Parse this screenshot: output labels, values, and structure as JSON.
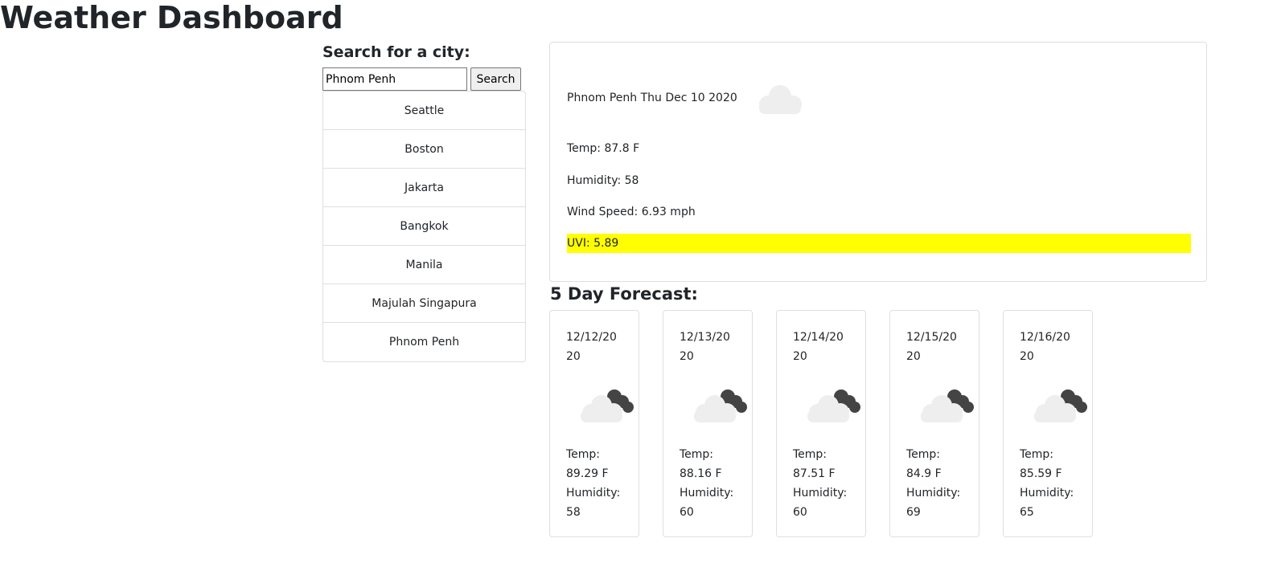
{
  "header": {
    "title": "Weather Dashboard"
  },
  "search": {
    "label": "Search for a city:",
    "input_value": "Phnom Penh",
    "button_label": "Search"
  },
  "history": [
    {
      "label": "Seattle"
    },
    {
      "label": "Boston"
    },
    {
      "label": "Jakarta"
    },
    {
      "label": "Bangkok"
    },
    {
      "label": "Manila"
    },
    {
      "label": "Majulah Singapura"
    },
    {
      "label": "Phnom Penh"
    }
  ],
  "current": {
    "heading": "Phnom Penh Thu Dec 10 2020",
    "icon": "cloud-icon",
    "temp": "Temp: 87.8 F",
    "humidity": "Humidity: 58",
    "wind": "Wind Speed: 6.93 mph",
    "uvi": "UVI: 5.89",
    "uvi_color": "#ffff00"
  },
  "forecast": {
    "heading": "5 Day Forecast:",
    "days": [
      {
        "date": "12/12/2020",
        "icon": "cloudy-icon",
        "temp_label": "Temp:",
        "temp": "89.29 F",
        "humidity_label": "Humidity:",
        "humidity": "58"
      },
      {
        "date": "12/13/2020",
        "icon": "cloudy-icon",
        "temp_label": "Temp:",
        "temp": "88.16 F",
        "humidity_label": "Humidity:",
        "humidity": "60"
      },
      {
        "date": "12/14/2020",
        "icon": "cloudy-icon",
        "temp_label": "Temp:",
        "temp": "87.51 F",
        "humidity_label": "Humidity:",
        "humidity": "60"
      },
      {
        "date": "12/15/2020",
        "icon": "cloudy-icon",
        "temp_label": "Temp:",
        "temp": "84.9 F",
        "humidity_label": "Humidity:",
        "humidity": "69"
      },
      {
        "date": "12/16/2020",
        "icon": "cloudy-icon",
        "temp_label": "Temp:",
        "temp": "85.59 F",
        "humidity_label": "Humidity:",
        "humidity": "65"
      }
    ]
  }
}
